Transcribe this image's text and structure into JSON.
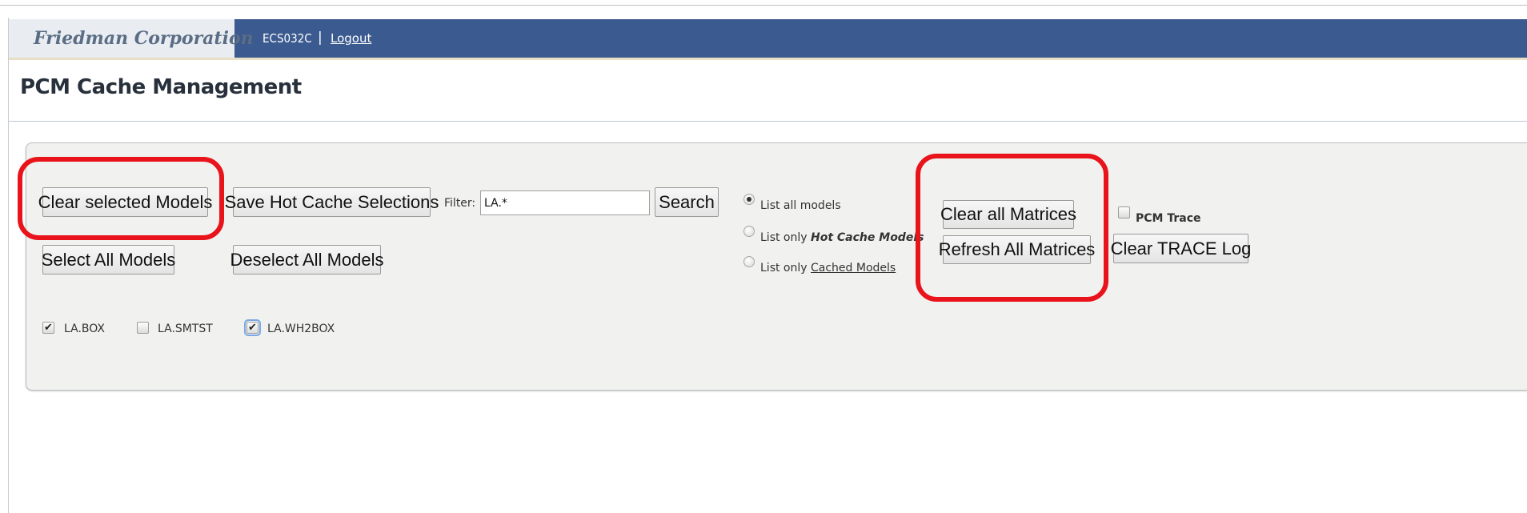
{
  "header": {
    "company": "Friedman Corporation",
    "user": "ECS032C",
    "separator": "|",
    "logout": "Logout"
  },
  "page_title": "PCM Cache Management",
  "buttons": {
    "clear_selected": "Clear selected Models",
    "save_hot": "Save Hot Cache Selections",
    "search": "Search",
    "select_all": "Select All Models",
    "deselect_all": "Deselect All Models",
    "clear_matrices": "Clear all Matrices",
    "refresh_matrices": "Refresh All Matrices",
    "clear_trace": "Clear TRACE Log"
  },
  "filter": {
    "label": "Filter:",
    "value": "LA.*"
  },
  "radios": [
    {
      "label": "List all models",
      "checked": true
    },
    {
      "label_prefix": "List only",
      "label_emph": "Hot Cache Models",
      "checked": false
    },
    {
      "label_prefix": "List only",
      "label_link": "Cached Models",
      "checked": false
    }
  ],
  "pcm_trace": {
    "label": "PCM Trace",
    "checked": false
  },
  "models": [
    {
      "name": "LA.BOX",
      "checked": true
    },
    {
      "name": "LA.SMTST",
      "checked": false
    },
    {
      "name": "LA.WH2BOX",
      "checked": true
    }
  ],
  "colors": {
    "header_bg": "#3b5a8f",
    "brand_bg": "#e9edf2",
    "highlight_ring": "#e8131b",
    "panel_bg": "#f1f2ef"
  }
}
